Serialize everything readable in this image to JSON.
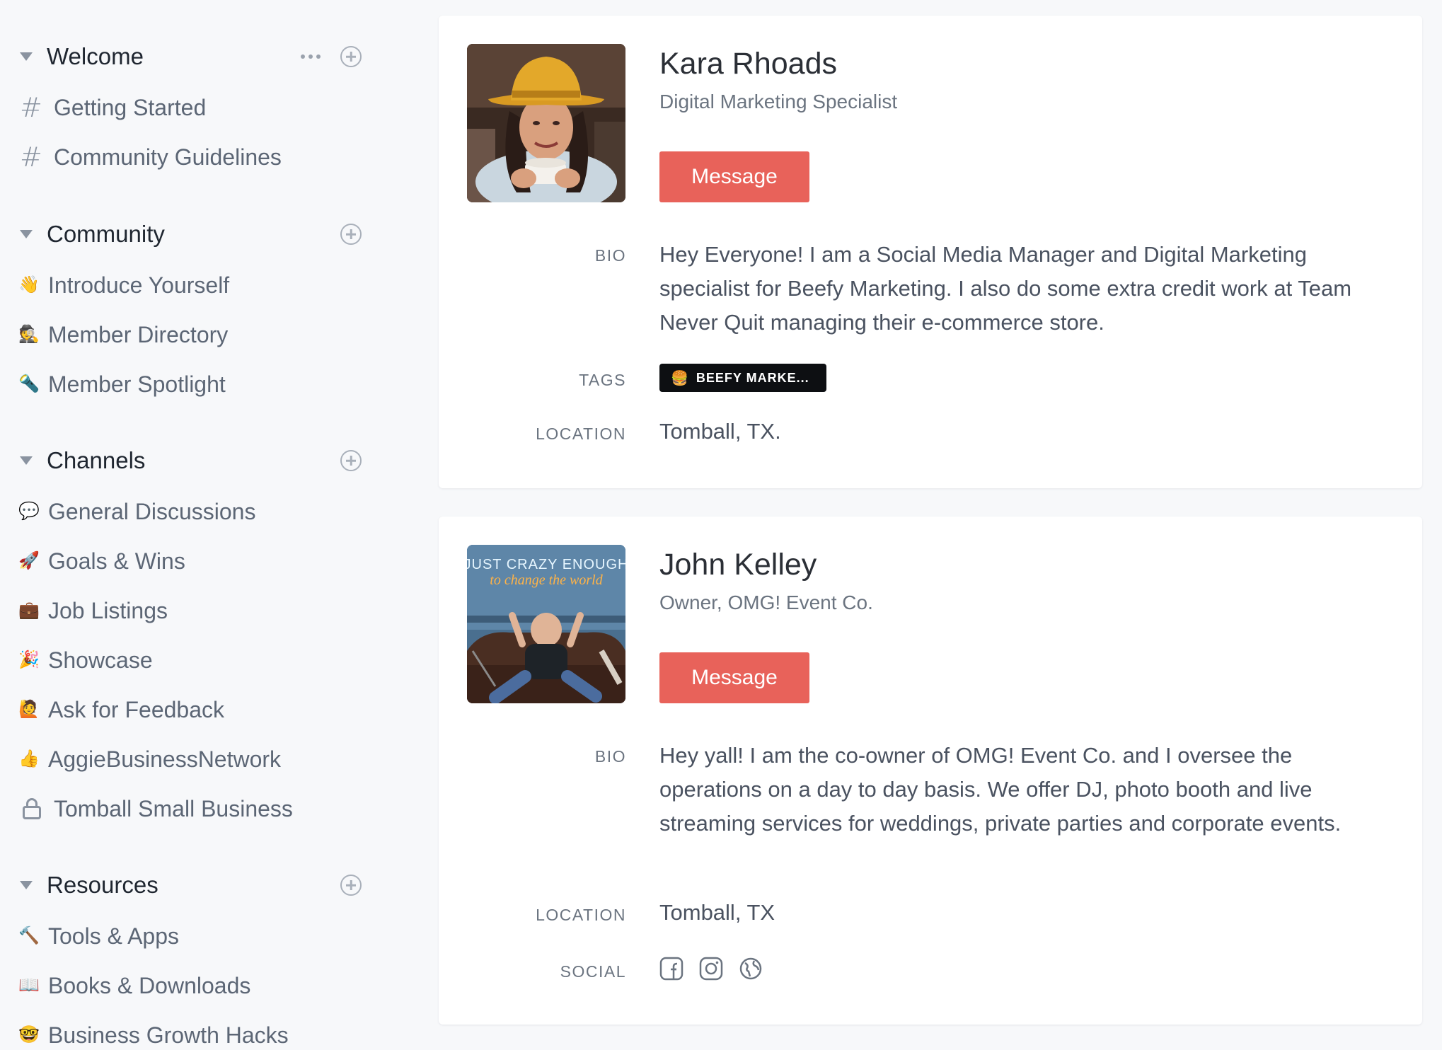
{
  "sidebar": {
    "sections": [
      {
        "title": "Welcome",
        "items": [
          {
            "icon": "hash-icon",
            "label": "Getting Started"
          },
          {
            "icon": "hash-icon",
            "label": "Community Guidelines"
          }
        ]
      },
      {
        "title": "Community",
        "items": [
          {
            "icon": "waving-hand-icon",
            "glyph": "👋",
            "label": "Introduce Yourself"
          },
          {
            "icon": "detective-icon",
            "glyph": "🕵",
            "label": "Member Directory"
          },
          {
            "icon": "flashlight-icon",
            "glyph": "🔦",
            "label": "Member Spotlight"
          }
        ]
      },
      {
        "title": "Channels",
        "items": [
          {
            "icon": "speech-bubble-icon",
            "glyph": "💬",
            "label": "General Discussions"
          },
          {
            "icon": "rocket-icon",
            "glyph": "🚀",
            "label": "Goals & Wins"
          },
          {
            "icon": "briefcase-icon",
            "glyph": "💼",
            "label": "Job Listings"
          },
          {
            "icon": "party-popper-icon",
            "glyph": "🎉",
            "label": "Showcase"
          },
          {
            "icon": "raising-hand-icon",
            "glyph": "🙋",
            "label": "Ask for Feedback"
          },
          {
            "icon": "thumbs-up-icon",
            "glyph": "👍",
            "label": "AggieBusinessNetwork"
          },
          {
            "icon": "lock-icon",
            "label": "Tomball Small Business"
          }
        ]
      },
      {
        "title": "Resources",
        "items": [
          {
            "icon": "hammer-icon",
            "glyph": "🔨",
            "label": "Tools & Apps"
          },
          {
            "icon": "open-book-icon",
            "glyph": "📖",
            "label": "Books & Downloads"
          },
          {
            "icon": "nerd-face-icon",
            "glyph": "🤓",
            "label": "Business Growth Hacks"
          }
        ]
      }
    ]
  },
  "members": [
    {
      "name": "Kara Rhoads",
      "role": "Digital Marketing Specialist",
      "message_label": "Message",
      "bio_label": "BIO",
      "bio": "Hey Everyone! I am a Social Media Manager and Digital Marketing specialist for Beefy Marketing. I also do some extra credit work at Team Never Quit managing their e-commerce store.",
      "tags_label": "TAGS",
      "tag": "BEEFY MARKE...",
      "tag_icon": "🍔",
      "location_label": "LOCATION",
      "location": "Tomball, TX."
    },
    {
      "name": "John Kelley",
      "role": "Owner, OMG! Event Co.",
      "message_label": "Message",
      "bio_label": "BIO",
      "bio": "Hey yall! I am the co-owner of OMG! Event Co. and I oversee the operations on a day to day basis. We offer DJ, photo booth and live streaming services for weddings, private parties and corporate events.",
      "location_label": "LOCATION",
      "location": "Tomball, TX",
      "social_label": "SOCIAL",
      "photo_text_line1": "JUST CRAZY ENOUGH",
      "photo_text_line2": "to change the world"
    }
  ],
  "colors": {
    "accent": "#e8625a",
    "background": "#f7f8fa",
    "card": "#ffffff",
    "tag_bg": "#0d0f12"
  }
}
